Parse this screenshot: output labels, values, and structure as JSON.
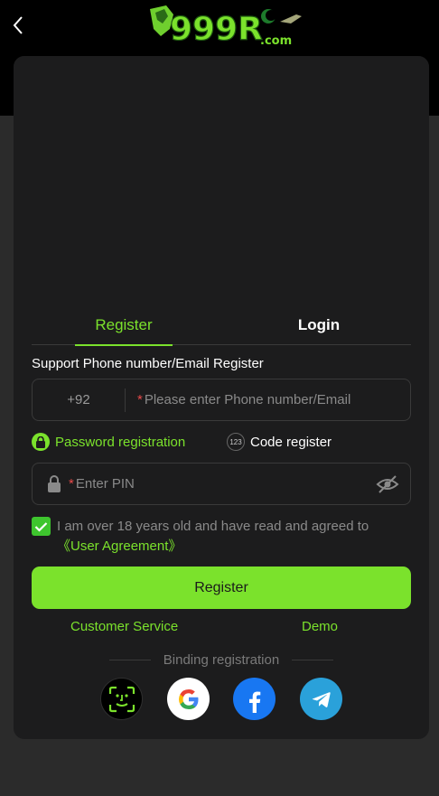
{
  "header": {
    "back_icon": "chevron-left-icon",
    "logo_text": "999R",
    "logo_suffix": ".com"
  },
  "tabs": [
    {
      "label": "Register",
      "active": true
    },
    {
      "label": "Login",
      "active": false
    }
  ],
  "form": {
    "support_label": "Support Phone number/Email Register",
    "country_code": "+92",
    "phone_placeholder": "Please enter Phone number/Email",
    "required_mark": "*",
    "password_option": "Password registration",
    "code_option": "Code register",
    "code_icon_text": "123",
    "pin_placeholder": "Enter PIN",
    "agreement_text": "I am over 18 years old and have read and agreed to ",
    "agreement_link": "《User Agreement》",
    "agreement_checked": true,
    "register_button": "Register"
  },
  "links": {
    "customer_service": "Customer Service",
    "demo": "Demo"
  },
  "binding": {
    "label": "Binding registration",
    "providers": [
      "face-id-icon",
      "google-icon",
      "facebook-icon",
      "telegram-icon"
    ]
  },
  "colors": {
    "accent": "#7be22c",
    "checkbox": "#3ec52e",
    "background": "#1c1c1d",
    "topbar": "#000000",
    "required": "#e84a4a"
  }
}
